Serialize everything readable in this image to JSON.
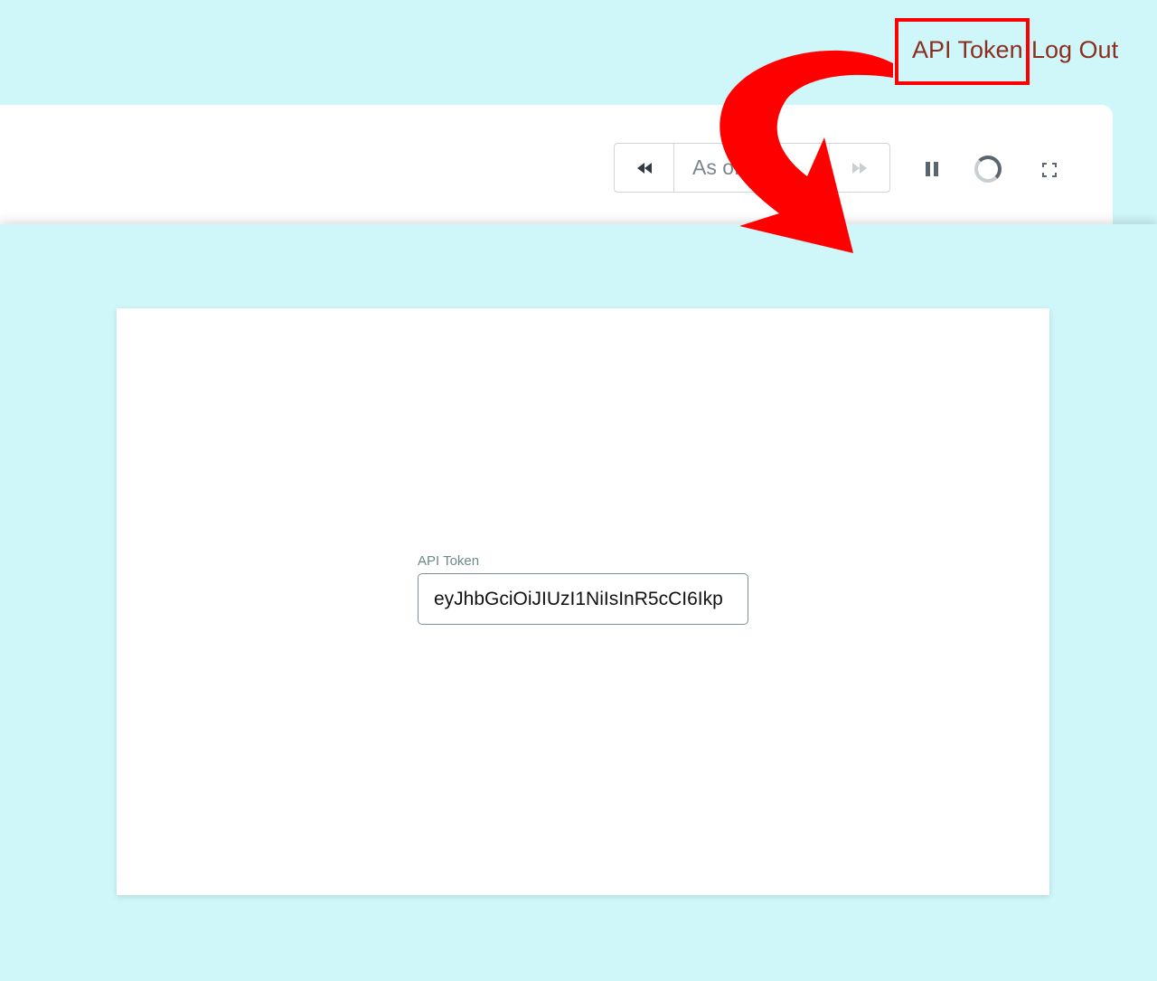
{
  "nav": {
    "api_token_label": "API Token",
    "logout_label": "Log Out"
  },
  "player": {
    "as_of_label": "As of:"
  },
  "modal": {
    "field_label": "API Token",
    "token_value": "eyJhbGciOiJIUzI1NiIsInR5cCI6Ikp"
  },
  "colors": {
    "background": "#cff6f9",
    "link": "#8b2e1f",
    "annotation": "#ff0000"
  },
  "icons": [
    "rewind-icon",
    "fast-forward-icon",
    "pause-icon",
    "loading-spinner-icon",
    "fullscreen-icon"
  ]
}
